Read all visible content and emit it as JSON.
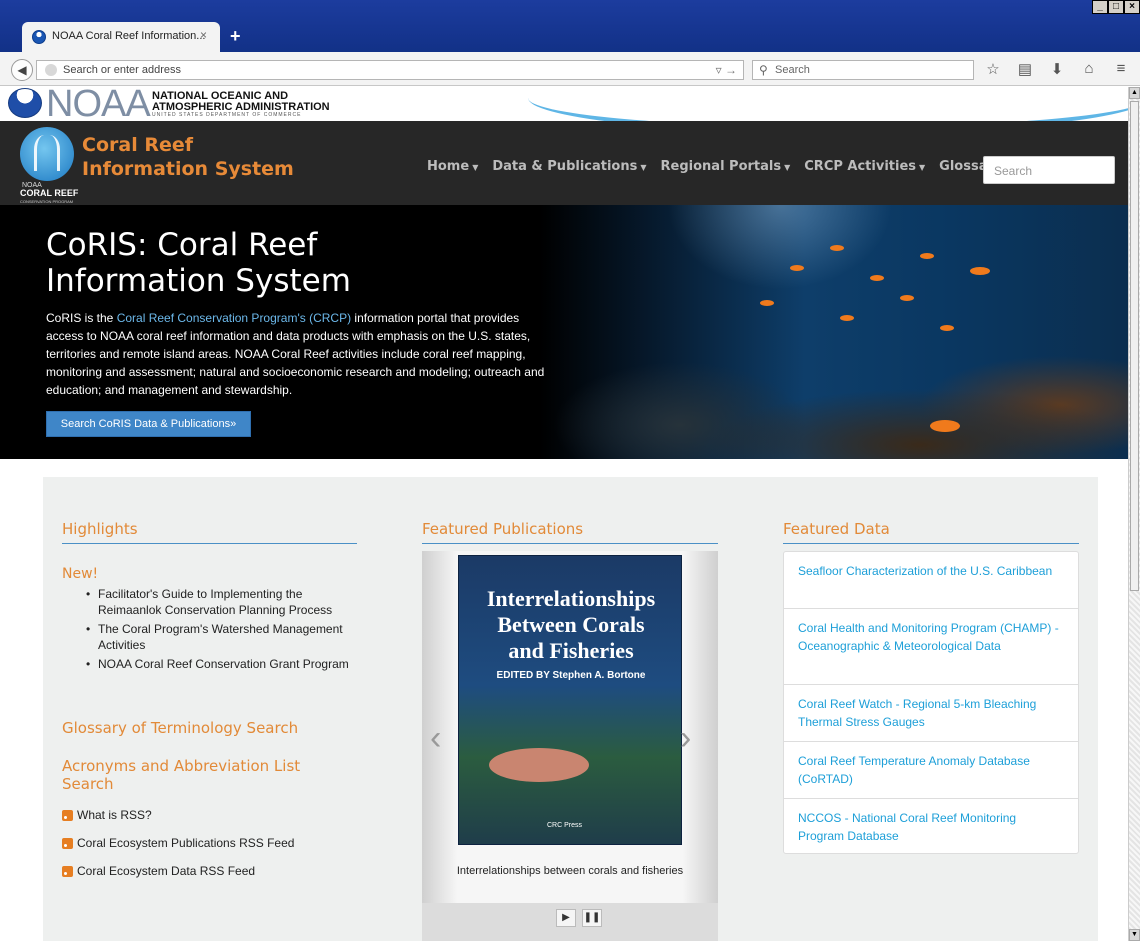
{
  "browser": {
    "tab_title": "NOAA Coral Reef Information...",
    "tab_close": "×",
    "new_tab": "+",
    "url_placeholder": "Search or enter address",
    "search_placeholder": "Search",
    "win_min": "_",
    "win_max": "□",
    "win_close": "×"
  },
  "noaa": {
    "logo_word": "NOAA",
    "name_line1": "NATIONAL OCEANIC AND",
    "name_line2": "ATMOSPHERIC ADMINISTRATION",
    "name_line3": "UNITED STATES DEPARTMENT OF COMMERCE"
  },
  "site": {
    "logo_sub1": "NOAA",
    "logo_sub2": "CORAL REEF",
    "logo_sub3": "CONSERVATION PROGRAM",
    "title_line1": "Coral Reef",
    "title_line2": "Information System",
    "nav": [
      "Home",
      "Data & Publications",
      "Regional Portals",
      "CRCP Activities",
      "Glossary"
    ],
    "search_placeholder": "Search"
  },
  "hero": {
    "title_line1": "CoRIS: Coral Reef",
    "title_line2": "Information System",
    "text_before": "CoRIS is the ",
    "text_link": "Coral Reef Conservation Program's (CRCP)",
    "text_after": " information portal that provides access to NOAA coral reef information and data products with emphasis on the U.S. states, territories and remote island areas. NOAA Coral Reef activities include coral reef mapping, monitoring and assessment; natural and socioeconomic research and modeling; outreach and education; and management and stewardship.",
    "button": "Search CoRIS Data & Publications»"
  },
  "highlights": {
    "heading": "Highlights",
    "new_label": "New!",
    "items": [
      "Facilitator's Guide to Implementing the Reimaanlok Conservation Planning Process",
      "The Coral Program's Watershed Management Activities",
      "NOAA Coral Reef Conservation Grant Program"
    ],
    "glossary_link": "Glossary of Terminology Search",
    "acronyms_link_1": "Acronyms and Abbreviation List",
    "acronyms_link_2": "Search",
    "rss": [
      "What is RSS?",
      "Coral Ecosystem Publications RSS Feed",
      "Coral Ecosystem Data RSS Feed"
    ]
  },
  "publications": {
    "heading": "Featured Publications",
    "book_title_1": "Interrelationships",
    "book_title_2": "Between Corals",
    "book_title_3": "and Fisheries",
    "book_editor": "EDITED BY Stephen A. Bortone",
    "book_publisher": "CRC Press",
    "caption": "Interrelationships between corals and fisheries",
    "prev": "‹",
    "next": "›",
    "play": "▶",
    "pause": "❚❚"
  },
  "featured_data": {
    "heading": "Featured Data",
    "items": [
      "Seafloor Characterization of the U.S. Caribbean",
      "Coral Health and Monitoring Program (CHAMP) - Oceanographic & Meteorological Data",
      "Coral Reef Watch - Regional 5-km Bleaching Thermal Stress Gauges",
      "Coral Reef Temperature Anomaly Database (CoRTAD)",
      "NCCOS - National Coral Reef Monitoring Program Database"
    ]
  }
}
